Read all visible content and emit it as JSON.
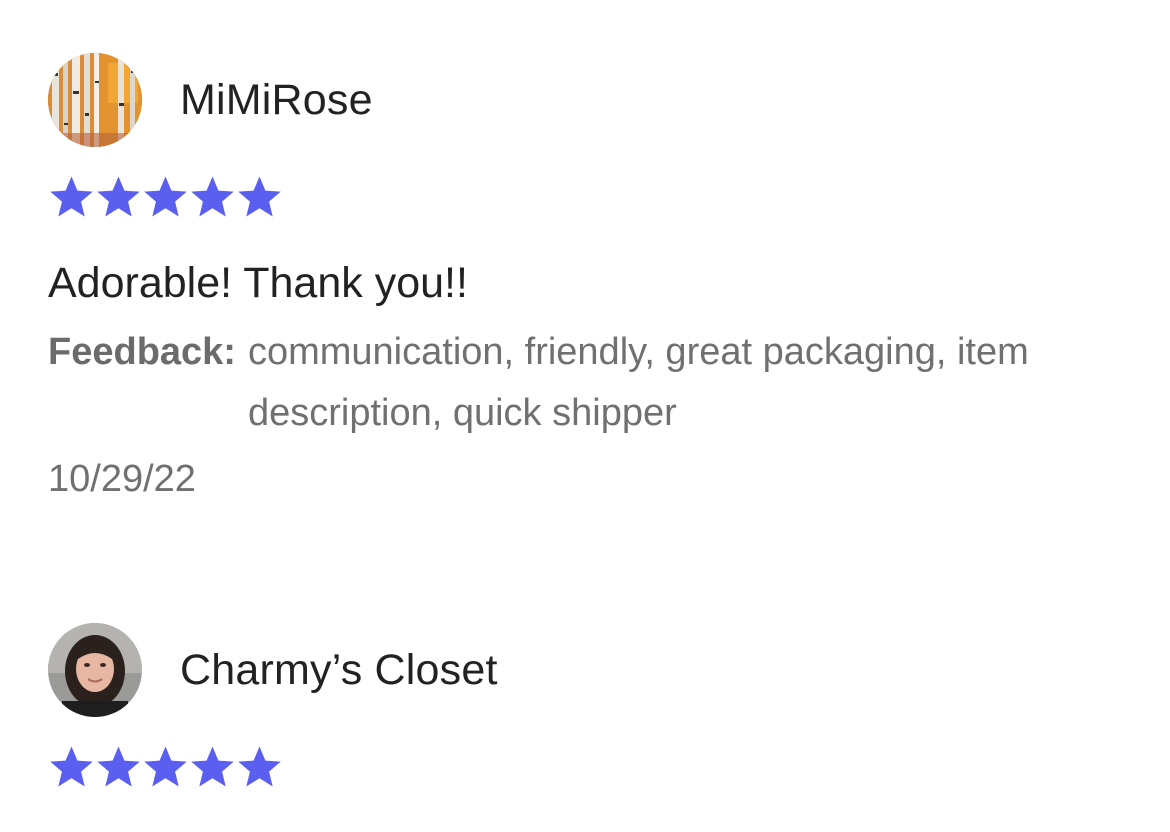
{
  "colors": {
    "star": "#5b5ff0",
    "username": "#222222",
    "secondary_text": "#707070"
  },
  "reviews": [
    {
      "username": "MiMiRose",
      "avatar": "avatar-birch-trees-painting",
      "rating": 5,
      "rating_max": 5,
      "text": "Adorable! Thank you!!",
      "feedback_label": "Feedback:",
      "feedback_tags": "communication, friendly, great packaging, item description, quick shipper",
      "date": "10/29/22"
    },
    {
      "username": "Charmy’s Closet",
      "avatar": "avatar-person-photo",
      "rating": 5,
      "rating_max": 5
    }
  ]
}
